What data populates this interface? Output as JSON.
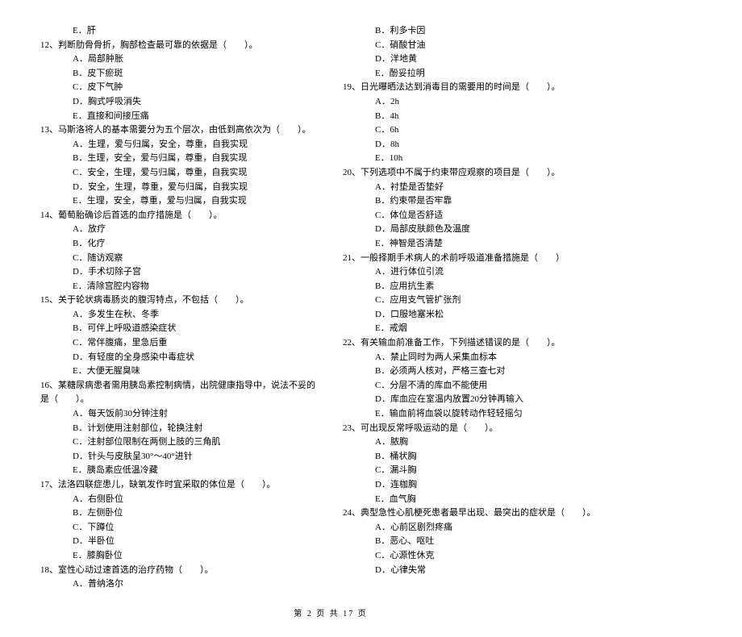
{
  "footer": "第 2 页 共 17 页",
  "col1": [
    {
      "type": "option",
      "text": "E．肝"
    },
    {
      "type": "stem",
      "text": "12、判断肋骨骨折，胸部检查最可靠的依据是（　　）。"
    },
    {
      "type": "option",
      "text": "A．局部肿胀"
    },
    {
      "type": "option",
      "text": "B．皮下瘀斑"
    },
    {
      "type": "option",
      "text": "C．皮下气肿"
    },
    {
      "type": "option",
      "text": "D．胸式呼吸消失"
    },
    {
      "type": "option",
      "text": "E．直接和间接压痛"
    },
    {
      "type": "stem",
      "text": "13、马斯洛将人的基本需要分为五个层次，由低到高依次为（　　）。"
    },
    {
      "type": "option",
      "text": "A．生理，爱与归属，安全，尊重，自我实现"
    },
    {
      "type": "option",
      "text": "B．生理，安全，爱与归属，尊重，自我实现"
    },
    {
      "type": "option",
      "text": "C．安全，生理，爱与归属，尊重，自我实现"
    },
    {
      "type": "option",
      "text": "D．安全，生理，尊重，爱与归属，自我实现"
    },
    {
      "type": "option",
      "text": "E．生理，安全，尊重，爱与归属，自我实现"
    },
    {
      "type": "stem",
      "text": "14、葡萄胎确诊后首选的血疗措施是（　　）。"
    },
    {
      "type": "option",
      "text": "A．放疗"
    },
    {
      "type": "option",
      "text": "B．化疗"
    },
    {
      "type": "option",
      "text": "C．随访观察"
    },
    {
      "type": "option",
      "text": "D．手术切除子宫"
    },
    {
      "type": "option",
      "text": "E．清除宫腔内容物"
    },
    {
      "type": "stem",
      "text": "15、关于轮状病毒肠炎的腹泻特点，不包括（　　）。"
    },
    {
      "type": "option",
      "text": "A．多发生在秋、冬季"
    },
    {
      "type": "option",
      "text": "B．可伴上呼吸道感染症状"
    },
    {
      "type": "option",
      "text": "C．常伴腹痛，里急后重"
    },
    {
      "type": "option",
      "text": "D．有轻度的全身感染中毒症状"
    },
    {
      "type": "option",
      "text": "E．大便无腥臭味"
    },
    {
      "type": "stem",
      "text": "16、某糖尿病患者需用胰岛素控制病情，出院健康指导中，说法不妥的是（　　）。"
    },
    {
      "type": "option",
      "text": "A．每天饭前30分钟注射"
    },
    {
      "type": "option",
      "text": "B．计划使用注射部位，轮换注射"
    },
    {
      "type": "option",
      "text": "C．注射部位限制在两侧上肢的三角肌"
    },
    {
      "type": "option",
      "text": "D．针头与皮肤呈30°～40°进针"
    },
    {
      "type": "option",
      "text": "E．胰岛素应低温冷藏"
    },
    {
      "type": "stem",
      "text": "17、法洛四联症患儿，缺氧发作时宜采取的体位是（　　）。"
    },
    {
      "type": "option",
      "text": "A．右侧卧位"
    },
    {
      "type": "option",
      "text": "B．左侧卧位"
    },
    {
      "type": "option",
      "text": "C．下蹲位"
    },
    {
      "type": "option",
      "text": "D．半卧位"
    },
    {
      "type": "option",
      "text": "E．膝胸卧位"
    },
    {
      "type": "stem",
      "text": "18、室性心动过速首选的治疗药物（　　）。"
    },
    {
      "type": "option",
      "text": "A．普纳洛尔"
    }
  ],
  "col2": [
    {
      "type": "option",
      "text": "B．利多卡因"
    },
    {
      "type": "option",
      "text": "C．硝酸甘油"
    },
    {
      "type": "option",
      "text": "D．洋地黄"
    },
    {
      "type": "option",
      "text": "E．酚妥拉明"
    },
    {
      "type": "stem",
      "text": "19、日光曝晒法达到消毒目的需要用的时间是（　　）。"
    },
    {
      "type": "option",
      "text": "A．2h"
    },
    {
      "type": "option",
      "text": "B．4h"
    },
    {
      "type": "option",
      "text": "C．6h"
    },
    {
      "type": "option",
      "text": "D．8h"
    },
    {
      "type": "option",
      "text": "E．10h"
    },
    {
      "type": "stem",
      "text": "20、下列选项中不属于约束带应观察的项目是（　　）。"
    },
    {
      "type": "option",
      "text": "A．衬垫是否垫好"
    },
    {
      "type": "option",
      "text": "B．约束带是否牢靠"
    },
    {
      "type": "option",
      "text": "C．体位是否舒适"
    },
    {
      "type": "option",
      "text": "D．局部皮肤颜色及温度"
    },
    {
      "type": "option",
      "text": "E．神智是否清楚"
    },
    {
      "type": "stem",
      "text": "21、一般择期手术病人的术前呼吸道准备措施是（　　）"
    },
    {
      "type": "option",
      "text": "A．进行体位引流"
    },
    {
      "type": "option",
      "text": "B．应用抗生素"
    },
    {
      "type": "option",
      "text": "C．应用支气管扩张剂"
    },
    {
      "type": "option",
      "text": "D．口服地塞米松"
    },
    {
      "type": "option",
      "text": "E．戒烟"
    },
    {
      "type": "stem",
      "text": "22、有关输血前准备工作，下列描述错误的是（　　）。"
    },
    {
      "type": "option",
      "text": "A．禁止同时为两人采集血标本"
    },
    {
      "type": "option",
      "text": "B．必须两人核对，严格三查七对"
    },
    {
      "type": "option",
      "text": "C．分层不清的库血不能使用"
    },
    {
      "type": "option",
      "text": "D．库血应在室温内放置20分钟再输入"
    },
    {
      "type": "option",
      "text": "E．输血前将血袋以旋转动作轻轻摇匀"
    },
    {
      "type": "stem",
      "text": "23、可出现反常呼吸运动的是（　　）。"
    },
    {
      "type": "option",
      "text": "A．脓胸"
    },
    {
      "type": "option",
      "text": "B．桶状胸"
    },
    {
      "type": "option",
      "text": "C．漏斗胸"
    },
    {
      "type": "option",
      "text": "D．连枷胸"
    },
    {
      "type": "option",
      "text": "E．血气胸"
    },
    {
      "type": "stem",
      "text": "24、典型急性心肌梗死患者最早出现、最突出的症状是（　　）。"
    },
    {
      "type": "option",
      "text": "A．心前区剧烈疼痛"
    },
    {
      "type": "option",
      "text": "B．恶心、呕吐"
    },
    {
      "type": "option",
      "text": "C．心源性休克"
    },
    {
      "type": "option",
      "text": "D．心律失常"
    }
  ]
}
